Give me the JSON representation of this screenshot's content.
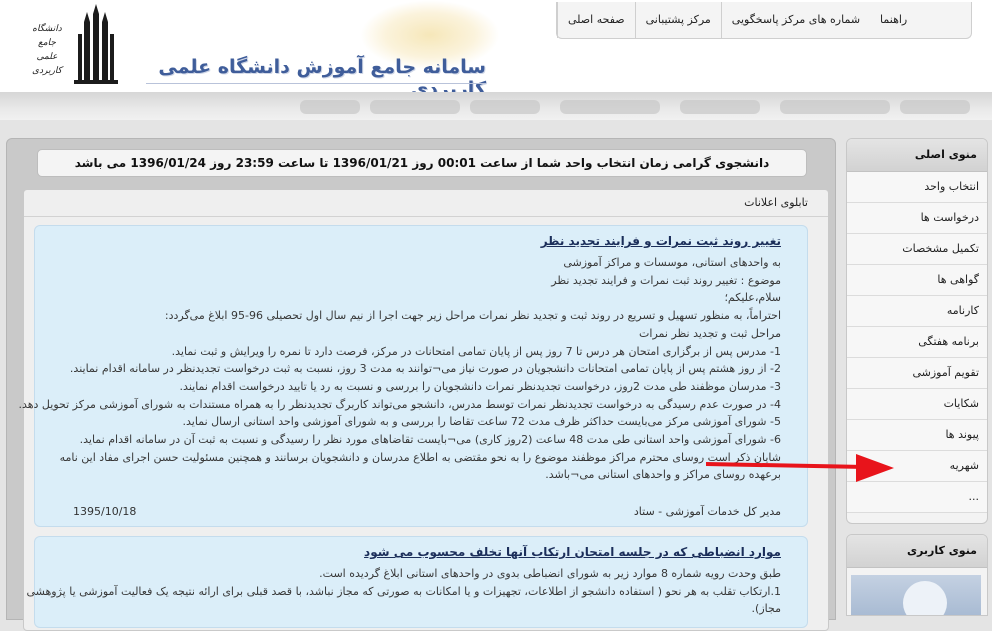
{
  "header": {
    "site_title": "سامانه جامع آموزش دانشگاه علمی کاربردی",
    "logo_text_line1": "دانشگاه جامع",
    "logo_text_line2": "علمی کاربردی"
  },
  "nav": {
    "items": [
      {
        "label": "صفحه اصلی"
      },
      {
        "label": "مرکز پشتیبانی"
      },
      {
        "label": "شماره های مرکز پاسخگویی"
      },
      {
        "label": "راهنما"
      }
    ]
  },
  "notice": {
    "text": "دانشجوی گرامی زمان انتخاب واحد شما از ساعت 00:01 روز 1396/01/21 تا ساعت 23:59 روز 1396/01/24 می باشد"
  },
  "board": {
    "title": "تابلوی اعلانات",
    "news": [
      {
        "title": "تغییر روند ثبت نمرات و فرایند تجدید نظر",
        "lines": [
          "به واحدهای استانی، موسسات و مراکز آموزشی",
          "موضوع : تغییر روند ثبت نمرات و فرایند تجدید نظر",
          "سلام،علیکم؛",
          "احتراماً، به منظور تسهیل و تسریع در روند ثبت و تجدید نظر نمرات مراحل زیر جهت اجرا از نیم سال اول تحصیلی 96-95 ابلاغ می‌گردد:",
          "مراحل ثبت و تجدید نظر نمرات",
          "1- مدرس پس از برگزاری امتحان هر درس تا 7 روز پس از پایان تمامی امتحانات در مرکز، فرصت دارد تا نمره را ویرایش و ثبت نماید.",
          "2- از روز هشتم پس از پایان تمامی امتحانات دانشجویان در صورت نیاز می¬توانند به مدت 3 روز، نسبت به ثبت درخواست تجدیدنظر در سامانه اقدام نمایند.",
          "3- مدرسان موظفند طی مدت 2روز، درخواست تجدیدنظر نمرات دانشجویان را بررسی و نسبت به رد یا تایید درخواست اقدام نمایند.",
          "4- در صورت عدم رسیدگی به درخواست تجدیدنظر نمرات توسط مدرس، دانشجو می‌تواند کاربرگ تجدیدنظر را به همراه مستندات به شورای آموزشی مرکز تحویل دهد.",
          "5- شورای آموزشی مرکز می‌بایست حداکثر ظرف مدت 72 ساعت تقاضا را بررسی و به شورای آموزشی واحد استانی ارسال نماید.",
          "6- شورای آموزشی واحد استانی طی مدت 48 ساعت (2روز کاری) می¬بایست تقاضاهای مورد نظر را رسیدگی و نسبت به ثبت آن در سامانه اقدام نماید.",
          "شایان ذکر است روسای محترم مراکز موظفند موضوع را به نحو مقتضی به اطلاع مدرسان و دانشجویان برسانند و همچنین مسئولیت حسن اجرای مفاد این نامه",
          "برعهده روسای مراکز و واحدهای استانی می¬باشد."
        ],
        "signature": "مدیر کل خدمات آموزشی - ستاد",
        "date": "1395/10/18"
      },
      {
        "title": "موارد انضباطی که در جلسه امتحان ارتکاب آنها تخلف محسوب می شود",
        "lines": [
          "طبق وحدت رویه شماره 8 موارد زیر به شورای انضباطی بدوی در واحدهای استانی ابلاغ گردیده است.",
          "1.ارتکاب تقلب به هر نحو ( استفاده دانشجو از اطلاعات، تجهیزات و یا امکانات به صورتی که مجاز نباشد، با قصد قبلی برای ارائه نتیجه یک فعالیت آموزشی یا پژوهشی",
          "مجاز)."
        ]
      }
    ]
  },
  "sidebar": {
    "title": "منوی اصلی",
    "items": [
      {
        "label": "انتخاب واحد"
      },
      {
        "label": "درخواست ها"
      },
      {
        "label": "تکمیل مشخصات"
      },
      {
        "label": "گواهی ها"
      },
      {
        "label": "کارنامه"
      },
      {
        "label": "برنامه هفتگی"
      },
      {
        "label": "تقویم آموزشی"
      },
      {
        "label": "شکایات"
      },
      {
        "label": "پیوند ها"
      },
      {
        "label": "شهریه"
      },
      {
        "label": "..."
      }
    ]
  },
  "sidebar2": {
    "title": "منوی کاربری"
  },
  "colors": {
    "accent_title": "#3f5d9a",
    "news_bg": "#dbeef9",
    "arrow": "#e8141b"
  }
}
